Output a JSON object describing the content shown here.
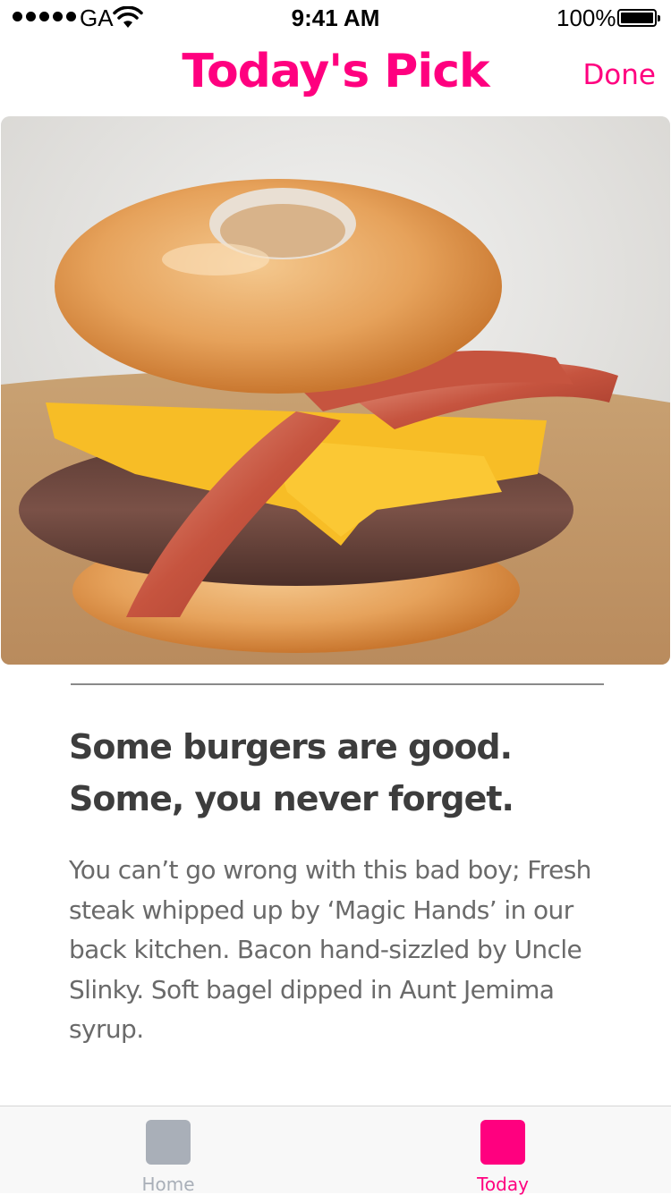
{
  "status_bar": {
    "carrier": "GA",
    "time": "9:41 AM",
    "battery_percent": "100%"
  },
  "nav": {
    "title": "Today's Pick",
    "done_label": "Done"
  },
  "hero": {
    "description": "Glazed donut bacon cheeseburger photo"
  },
  "article": {
    "headline": "Some burgers are good. Some, you never forget.",
    "body": "You can’t go wrong with this bad boy; Fresh steak whipped up by ‘Magic Hands’ in our back kitchen. Bacon hand-sizzled by Uncle Slinky. Soft bagel dipped in Aunt Jemima syrup."
  },
  "tab_bar": {
    "tabs": [
      {
        "label": "Home",
        "selected": false,
        "color": "#a9afb8"
      },
      {
        "label": "Today",
        "selected": true,
        "color": "#ff007f"
      }
    ]
  },
  "colors": {
    "accent": "#ff007f",
    "inactive": "#a9afb8",
    "headline": "#3d3d3d",
    "body": "#6a6a6a"
  }
}
